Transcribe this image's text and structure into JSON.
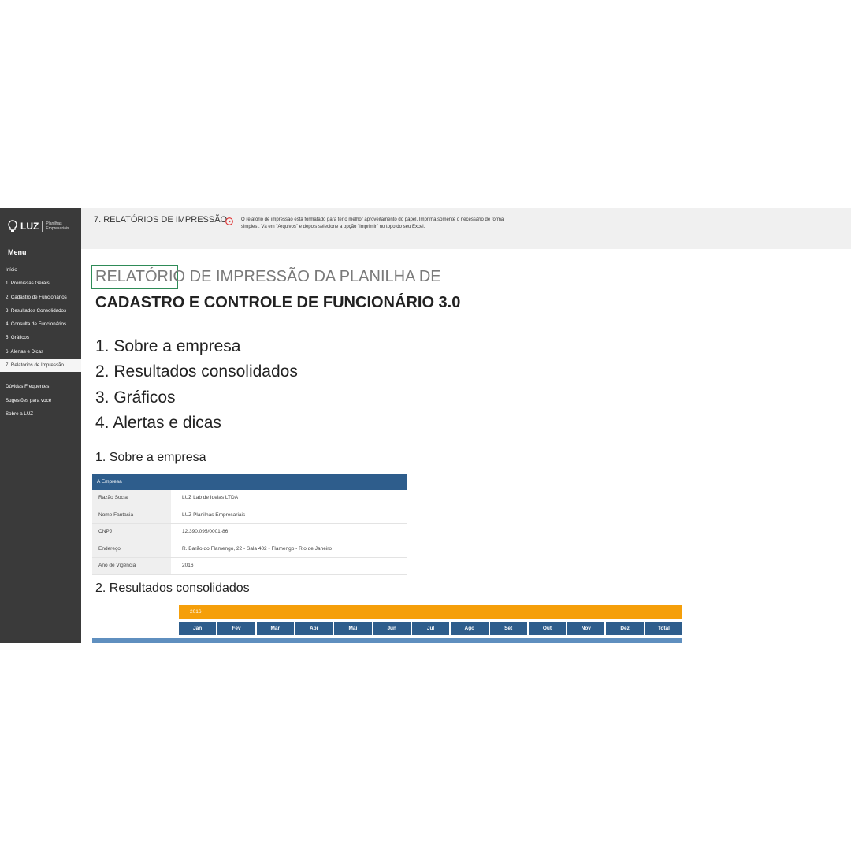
{
  "sidebar": {
    "logo_name": "LUZ",
    "logo_subtitle": "Planilhas Empresariais",
    "menu_title": "Menu",
    "items": [
      {
        "label": "Início"
      },
      {
        "label": "1. Premissas Gerais"
      },
      {
        "label": "2. Cadastro de Funcionários"
      },
      {
        "label": "3. Resultados Consolidados"
      },
      {
        "label": "4. Consulta de Funcionários"
      },
      {
        "label": "5. Gráficos"
      },
      {
        "label": "6. Alertas e Dicas"
      },
      {
        "label": "7. Relatórios de Impressão",
        "active": true
      }
    ],
    "extra_items": [
      {
        "label": "Dúvidas Frequentes"
      },
      {
        "label": "Sugestões para você"
      },
      {
        "label": "Sobre a LUZ"
      }
    ]
  },
  "header": {
    "title": "7. RELATÓRIOS DE IMPRESSÃO",
    "info_icon": "play-circle-icon",
    "info_text": "O relatório de impressão está formatado para ter o melhor aproveitamento do papel. Imprima somente o necessário de forma simples . Vá em \"Arquivos\" e depois selecione a opção \"Imprimir\" no topo do seu Excel."
  },
  "report": {
    "title_line1": "RELATÓRIO DE IMPRESSÃO DA PLANILHA DE",
    "title_line2": "CADASTRO E CONTROLE DE FUNCIONÁRIO 3.0",
    "toc": [
      "1. Sobre a empresa",
      "2. Resultados consolidados",
      "3. Gráficos",
      "4. Alertas e dicas"
    ]
  },
  "company": {
    "section_title": "1. Sobre a empresa",
    "table_title": "A Empresa",
    "rows": [
      {
        "label": "Razão Social",
        "value": "LUZ Lab de Ideias LTDA"
      },
      {
        "label": "Nome Fantasia",
        "value": "LUZ Planilhas Empresariais"
      },
      {
        "label": "CNPJ",
        "value": "12.390.095/0001-86"
      },
      {
        "label": "Endereço",
        "value": "R. Barão do Flamengo, 22 - Sala 402 - Flamengo - Rio de Janeiro"
      },
      {
        "label": "Ano de Vigência",
        "value": "2016"
      }
    ]
  },
  "results": {
    "section_title": "2. Resultados consolidados",
    "year": "2016",
    "months": [
      "Jan",
      "Fev",
      "Mar",
      "Abr",
      "Mai",
      "Jun",
      "Jul",
      "Ago",
      "Set",
      "Out",
      "Nov",
      "Dez",
      "Total"
    ]
  },
  "colors": {
    "sidebar_bg": "#3a3a3a",
    "table_header": "#2e5d8c",
    "year_bar": "#f59f0a",
    "accent_red": "#e03030"
  }
}
